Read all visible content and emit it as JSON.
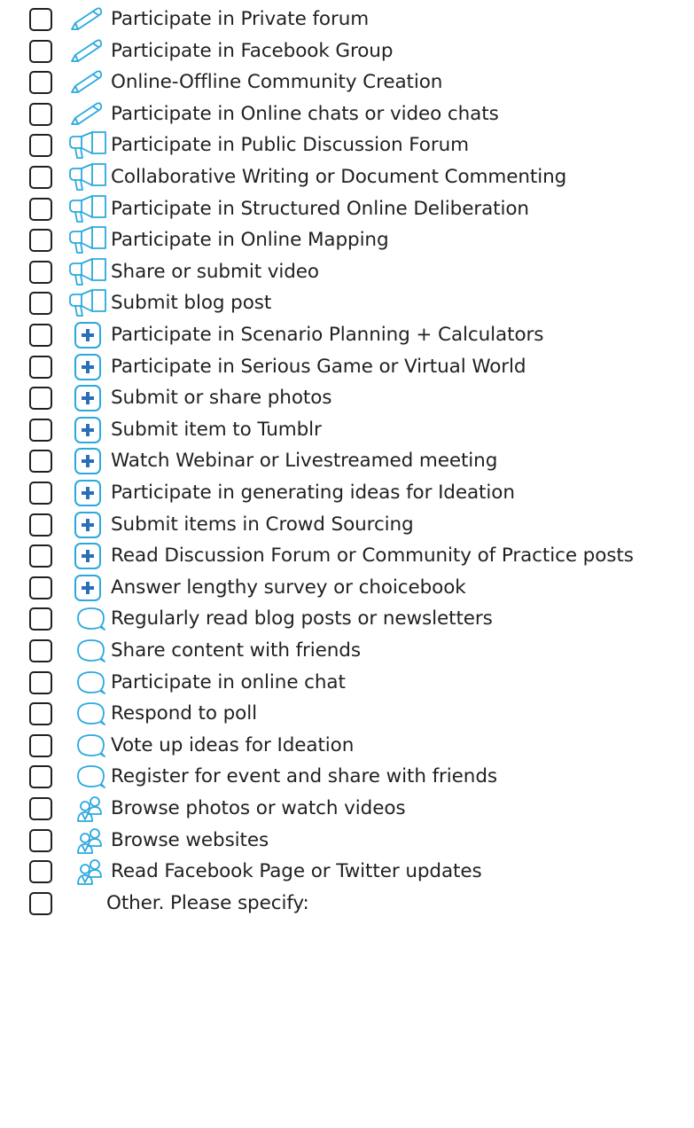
{
  "accent_color": "#2aa9df",
  "items": [
    {
      "icon": "pencil-icon",
      "label": "Participate in Private forum"
    },
    {
      "icon": "pencil-icon",
      "label": "Participate in Facebook Group"
    },
    {
      "icon": "pencil-icon",
      "label": "Online-Offline Community Creation"
    },
    {
      "icon": "pencil-icon",
      "label": "Participate in Online chats or video chats"
    },
    {
      "icon": "megaphone-icon",
      "label": "Participate in Public Discussion Forum"
    },
    {
      "icon": "megaphone-icon",
      "label": "Collaborative Writing or Document Commenting"
    },
    {
      "icon": "megaphone-icon",
      "label": "Participate in Structured Online Deliberation"
    },
    {
      "icon": "megaphone-icon",
      "label": "Participate in Online Mapping"
    },
    {
      "icon": "megaphone-icon",
      "label": "Share or submit video"
    },
    {
      "icon": "megaphone-icon",
      "label": "Submit blog post"
    },
    {
      "icon": "plus-icon",
      "label": "Participate in Scenario Planning + Calculators"
    },
    {
      "icon": "plus-icon",
      "label": "Participate in Serious Game or Virtual World"
    },
    {
      "icon": "plus-icon",
      "label": "Submit or share photos"
    },
    {
      "icon": "plus-icon",
      "label": "Submit item to Tumblr"
    },
    {
      "icon": "plus-icon",
      "label": "Watch Webinar or Livestreamed meeting"
    },
    {
      "icon": "plus-icon",
      "label": "Participate in generating ideas for Ideation"
    },
    {
      "icon": "plus-icon",
      "label": "Submit items in Crowd Sourcing"
    },
    {
      "icon": "plus-icon",
      "label": "Read Discussion Forum or Community of Practice posts"
    },
    {
      "icon": "plus-icon",
      "label": "Answer lengthy survey or choicebook"
    },
    {
      "icon": "speech-bubble-icon",
      "label": "Regularly read blog posts or newsletters"
    },
    {
      "icon": "speech-bubble-icon",
      "label": "Share content with friends"
    },
    {
      "icon": "speech-bubble-icon",
      "label": "Participate in online chat"
    },
    {
      "icon": "speech-bubble-icon",
      "label": "Respond to poll"
    },
    {
      "icon": "speech-bubble-icon",
      "label": "Vote up ideas for Ideation"
    },
    {
      "icon": "speech-bubble-icon",
      "label": "Register for event and share with friends"
    },
    {
      "icon": "people-icon",
      "label": "Browse photos or watch videos"
    },
    {
      "icon": "people-icon",
      "label": "Browse websites"
    },
    {
      "icon": "people-icon",
      "label": "Read Facebook Page or Twitter updates"
    }
  ],
  "other": {
    "label": "Other. Please specify:"
  }
}
